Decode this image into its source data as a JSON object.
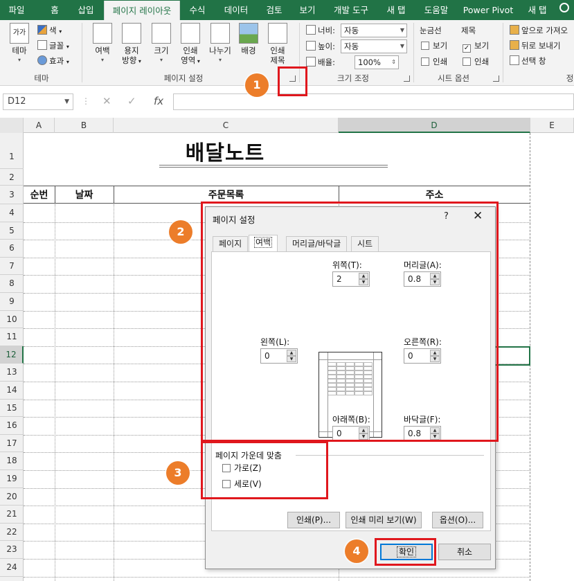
{
  "ribbon_tabs": [
    "파일",
    "홈",
    "삽입",
    "페이지 레이아웃",
    "수식",
    "데이터",
    "검토",
    "보기",
    "개발 도구",
    "새 탭",
    "도움말",
    "Power Pivot",
    "새 탭"
  ],
  "ribbon": {
    "theme": {
      "label": "테마",
      "group": "테마",
      "colors": "색",
      "fonts": "글꼴",
      "effects": "효과",
      "icon_text": "가가"
    },
    "page_setup": {
      "group": "페이지 설정",
      "margins": "여백",
      "orientation_1": "용지",
      "orientation_2": "방향",
      "size": "크기",
      "print_area_1": "인쇄",
      "print_area_2": "영역",
      "breaks": "나누기",
      "background": "배경",
      "titles_1": "인쇄",
      "titles_2": "제목"
    },
    "scale": {
      "group": "크기 조정",
      "width_label": "너비:",
      "width_value": "자동",
      "height_label": "높이:",
      "height_value": "자동",
      "scale_label": "배율:",
      "scale_value": "100%"
    },
    "sheet_options": {
      "group": "시트 옵션",
      "gridlines": "눈금선",
      "headings": "제목",
      "view": "보기",
      "print": "인쇄"
    },
    "arrange": {
      "bring_forward": "앞으로 가져오",
      "send_backward": "뒤로 보내기",
      "selection_pane": "선택 창",
      "group_partial": "정"
    }
  },
  "formula_bar": {
    "name_box": "D12",
    "cancel": "✕",
    "enter": "✓",
    "fx": "fx"
  },
  "columns": [
    "A",
    "B",
    "C",
    "D",
    "E"
  ],
  "rows": [
    "1",
    "2",
    "3",
    "4",
    "5",
    "6",
    "7",
    "8",
    "9",
    "10",
    "11",
    "12",
    "13",
    "14",
    "15",
    "16",
    "17",
    "18",
    "19",
    "20",
    "21",
    "22",
    "23",
    "24"
  ],
  "sheet": {
    "title": "배달노트",
    "headers": [
      "순번",
      "날짜",
      "주문목록",
      "주소"
    ]
  },
  "dialog": {
    "title": "페이지 설정",
    "help": "?",
    "close": "✕",
    "tabs": [
      "페이지",
      "여백",
      "머리글/바닥글",
      "시트"
    ],
    "top_label": "위쪽(T):",
    "top_value": "2",
    "header_label": "머리글(A):",
    "header_value": "0.8",
    "left_label": "왼쪽(L):",
    "left_value": "0",
    "right_label": "오른쪽(R):",
    "right_value": "0",
    "bottom_label": "아래쪽(B):",
    "bottom_value": "0",
    "footer_label": "바닥글(F):",
    "footer_value": "0.8",
    "center_title": "페이지 가운데 맞춤",
    "horizontal": "가로(Z)",
    "vertical": "세로(V)",
    "print_btn": "인쇄(P)...",
    "preview_btn": "인쇄 미리 보기(W)",
    "options_btn": "옵션(O)...",
    "ok_btn": "확인",
    "cancel_btn": "취소"
  },
  "annotations": [
    "1",
    "2",
    "3",
    "4"
  ],
  "accent_colors": {
    "excel_green": "#217346",
    "annotation_red": "#e0171d",
    "badge_orange": "#ec7d2a"
  }
}
